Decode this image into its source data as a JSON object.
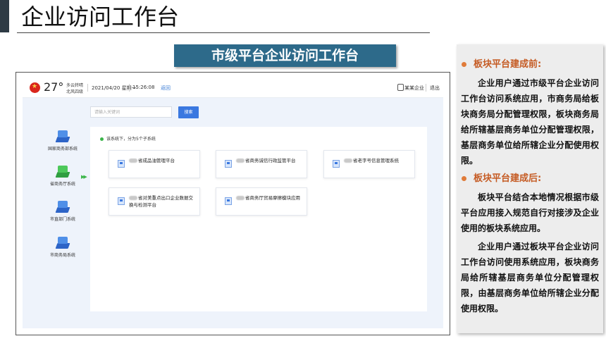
{
  "page_title": "企业访问工作台",
  "banner": "市级平台企业访问工作台",
  "app": {
    "temperature": "27°",
    "weather": [
      "多云转晴",
      "北风四级"
    ],
    "date": "2021/04/20 星期一",
    "time": "15:26:08",
    "back": "返回",
    "user": "某某企业",
    "logout": "退出",
    "search_placeholder": "请输入关键词",
    "search_button": "搜索",
    "sidebar": [
      {
        "label": "国家商务部系统",
        "color": "blue"
      },
      {
        "label": "省商务厅系统",
        "color": "green",
        "active": true
      },
      {
        "label": "市直部门系统",
        "color": "blue"
      },
      {
        "label": "市商务局系统",
        "color": "blue"
      }
    ],
    "panel_header": "该系统下，分为5个子系统",
    "subsystems": [
      "省成品油管理平台",
      "省商务诚信行政监管平台",
      "省老字号信息管理系统",
      "省对美重点出口企业数据交换与检测平台",
      "省商务厅贸易摩擦模块应用"
    ]
  },
  "notes": {
    "before_title": "板块平台建成前:",
    "before_text": "企业用户通过市级平台企业访问工作台访问系统应用，市商务局给板块商务局分配管理权限，板块商务局给所辖基层商务单位分配管理权限，基层商务单位给所辖企业分配使用权限。",
    "after_title": "板块平台建成后:",
    "after_text_1": "板块平台结合本地情况根据市级平台应用接入规范自行对接涉及企业使用的板块系统应用。",
    "after_text_2": "企业用户通过板块平台企业访问工作台访问使用系统应用，板块商务局给所辖基层商务单位分配管理权限，由基层商务单位给所辖企业分配使用权限。"
  },
  "colors": {
    "accent": "#2d6a8a",
    "button": "#3a78e0",
    "note_head": "#c55a22"
  }
}
